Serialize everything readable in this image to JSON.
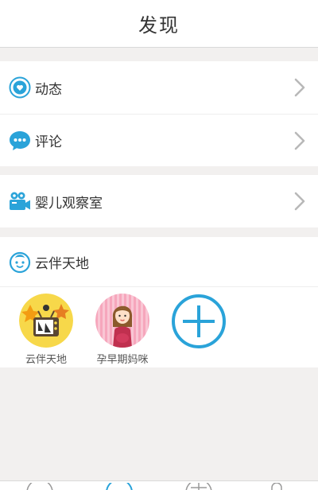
{
  "header": {
    "title": "发现"
  },
  "menu": {
    "moments_label": "动态",
    "comments_label": "评论",
    "baby_label": "婴儿观察室"
  },
  "community": {
    "title": "云伴天地",
    "groups": [
      {
        "label": "云伴天地"
      },
      {
        "label": "孕早期妈咪"
      }
    ]
  },
  "colors": {
    "accent": "#2aa3d9",
    "background": "#f2f0ef"
  },
  "icons": {
    "moments": "heart-bubble-icon",
    "comments": "chat-bubble-icon",
    "baby": "video-camera-icon",
    "community": "baby-face-icon",
    "chevron": "chevron-right-icon",
    "add": "plus-circle-icon"
  }
}
